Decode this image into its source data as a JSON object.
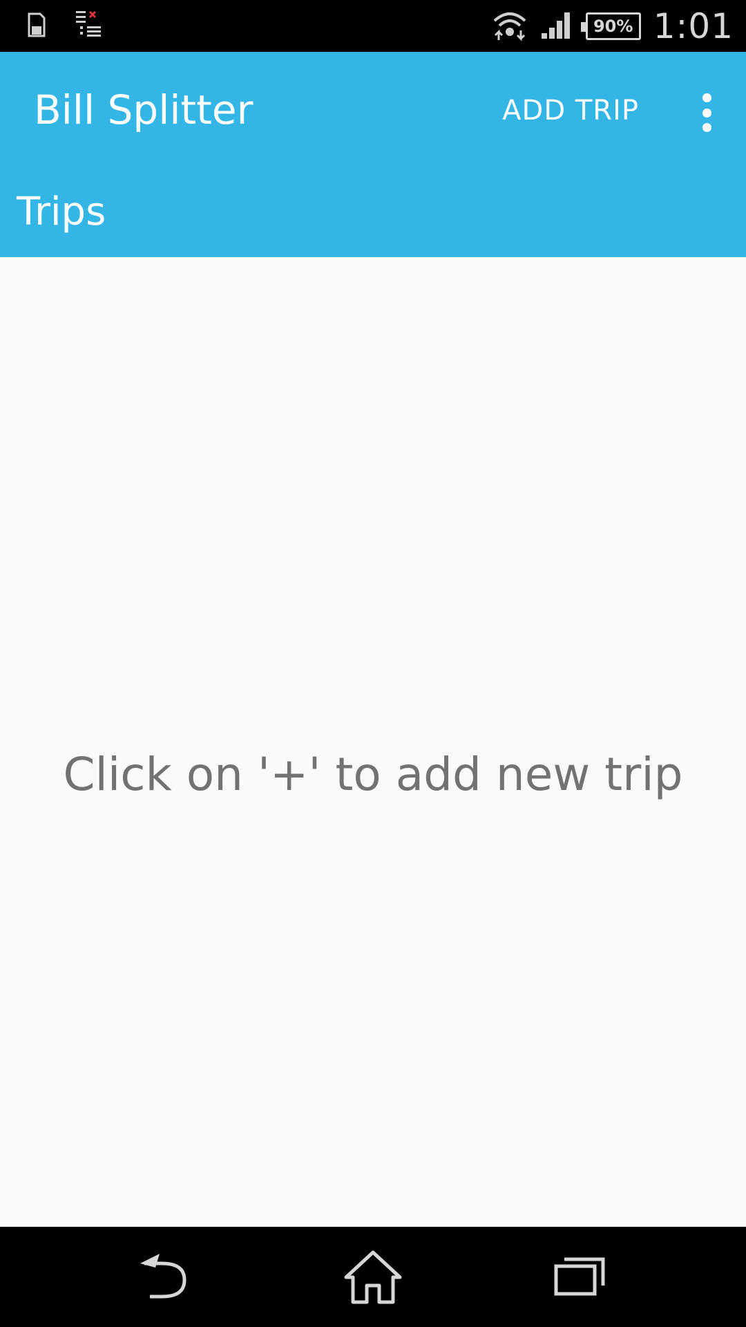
{
  "status_bar": {
    "left_icons": [
      "sd-card-icon",
      "notification-list-icon"
    ],
    "right_icons": [
      "wifi-icon",
      "cell-signal-icon"
    ],
    "battery_level": "90%",
    "time": "1:01"
  },
  "app_bar": {
    "title": "Bill Splitter",
    "action_label": "ADD TRIP",
    "overflow_icon": "overflow-menu-icon",
    "section_title": "Trips",
    "color": "#33b5e5"
  },
  "content": {
    "empty_message": "Click on '+' to add new trip"
  },
  "nav_bar": {
    "buttons": [
      "back-icon",
      "home-icon",
      "recents-icon"
    ]
  }
}
